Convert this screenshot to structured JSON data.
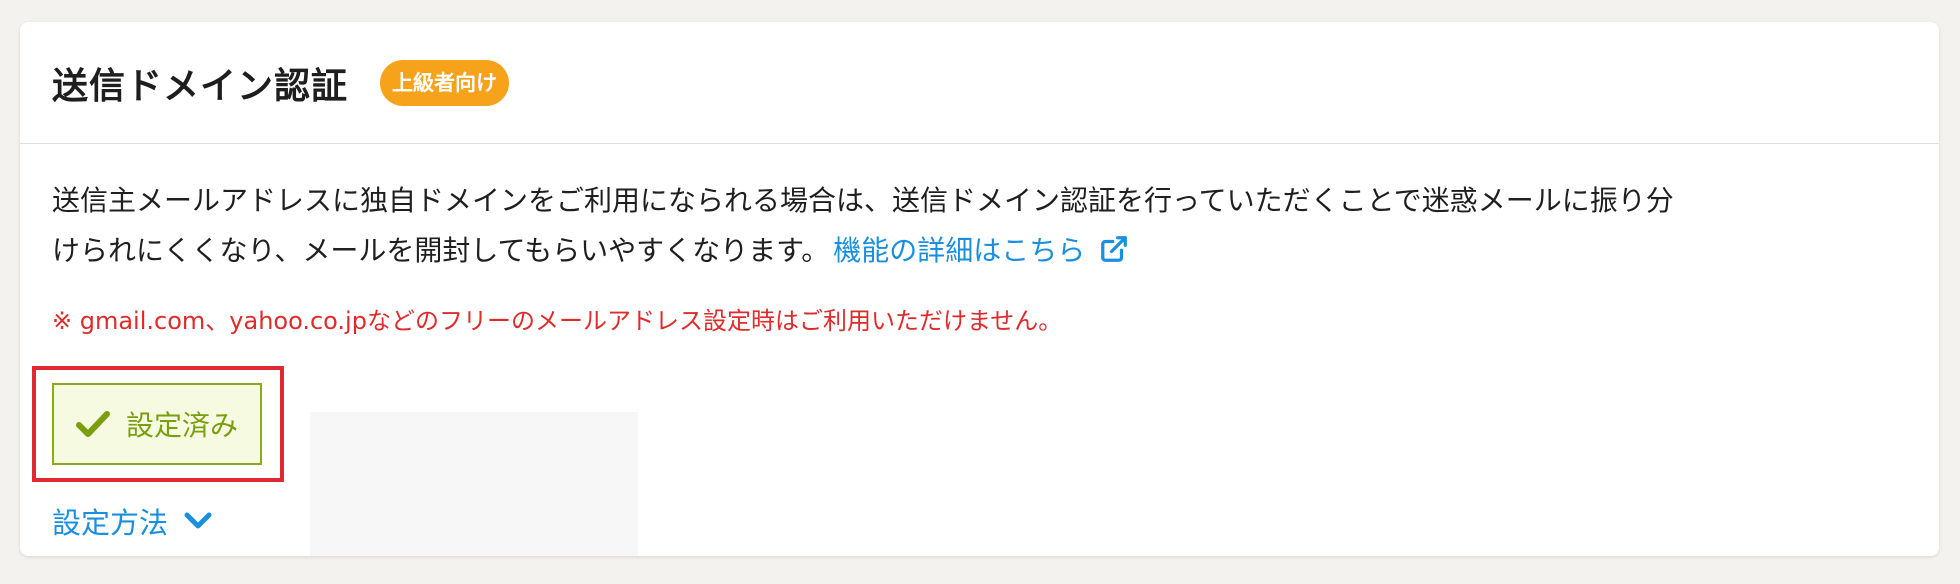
{
  "header": {
    "title": "送信ドメイン認証",
    "badge": "上級者向け"
  },
  "description": {
    "line1": "送信主メールアドレスに独自ドメインをご利用になられる場合は、送信ドメイン認証を行っていただくことで迷惑メールに振り分",
    "line2": "けられにくくなり、メールを開封してもらいやすくなります。",
    "link_label": "機能の詳細はこちら"
  },
  "note": "※ gmail.com、yahoo.co.jpなどのフリーのメールアドレス設定時はご利用いただけません。",
  "status": {
    "label": "設定済み"
  },
  "howto": {
    "label": "設定方法"
  },
  "icons": {
    "external_link": "external-link-icon",
    "check": "check-icon",
    "chevron": "chevron-down-icon"
  },
  "colors": {
    "badge": "#f6a31b",
    "link": "#1a8fe0",
    "note": "#e02b2b",
    "status_text": "#7a9e10",
    "status_border": "#8aab18",
    "status_bg": "#f6fae0",
    "highlight": "#e0282e"
  }
}
